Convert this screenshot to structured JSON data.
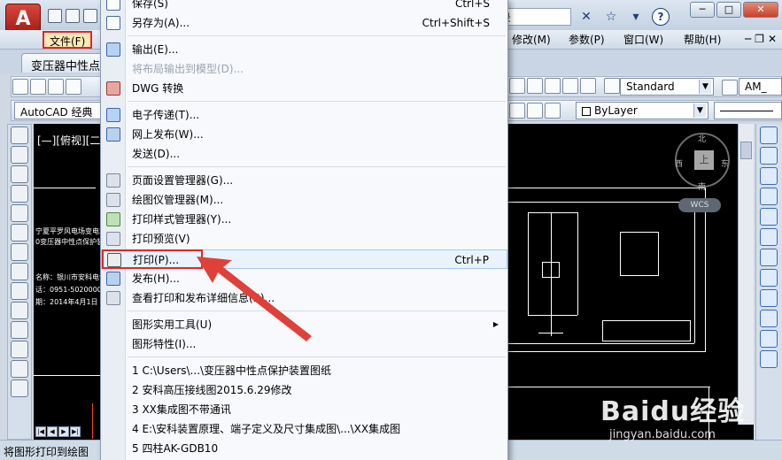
{
  "app": {
    "logo_letter": "A",
    "search_value": "录"
  },
  "menubar": {
    "file": "文件(F)",
    "items": [
      "修改(M)",
      "参数(P)",
      "窗口(W)",
      "帮助(H)"
    ]
  },
  "document_tab": "变压器中性点",
  "toolbar": {
    "workspace": "AutoCAD 经典",
    "text_style": "Standard",
    "dim_style": "AM_",
    "layer_combo": "ByLayer"
  },
  "drawing": {
    "viewport_label": "[—][俯视][二维",
    "viewcube": {
      "top_face": "上",
      "north": "北",
      "south": "南",
      "east": "东",
      "west": "西",
      "wcs": "WCS"
    },
    "title_texts": [
      "宁夏平罗风电场变电站一",
      "0变压器中性点保护装置"
    ],
    "info_texts": [
      "名称：银川市安科电气有限",
      "话：0951-5020000",
      "期：2014年4月1日"
    ]
  },
  "status_bar": "将图形打印到绘图",
  "file_menu": {
    "items": [
      {
        "label": "保存(S)",
        "shortcut": "Ctrl+S",
        "icon": "save-icon"
      },
      {
        "label": "另存为(A)...",
        "shortcut": "Ctrl+Shift+S",
        "icon": "save-as-icon"
      },
      {
        "label": "输出(E)...",
        "icon": "export-icon"
      },
      {
        "label": "将布局输出到模型(D)...",
        "disabled": true
      },
      {
        "label": "DWG 转换",
        "icon": "dwg-convert-icon"
      },
      {
        "label": "电子传递(T)...",
        "icon": "etransmit-icon"
      },
      {
        "label": "网上发布(W)...",
        "icon": "publish-web-icon"
      },
      {
        "label": "发送(D)..."
      },
      {
        "label": "页面设置管理器(G)...",
        "icon": "page-setup-icon"
      },
      {
        "label": "绘图仪管理器(M)...",
        "icon": "plotter-manager-icon"
      },
      {
        "label": "打印样式管理器(Y)...",
        "icon": "plot-style-icon"
      },
      {
        "label": "打印预览(V)",
        "icon": "plot-preview-icon"
      },
      {
        "label": "打印(P)...",
        "shortcut": "Ctrl+P",
        "icon": "print-icon"
      },
      {
        "label": "发布(H)...",
        "icon": "publish-icon"
      },
      {
        "label": "查看打印和发布详细信息(B)...",
        "icon": "plot-details-icon"
      },
      {
        "label": "图形实用工具(U)",
        "submenu": true
      },
      {
        "label": "图形特性(I)..."
      },
      {
        "label": "1 C:\\Users\\...\\变压器中性点保护装置图纸"
      },
      {
        "label": "2 安科高压接线图2015.6.29修改"
      },
      {
        "label": "3 XX集成图不带通讯"
      },
      {
        "label": "4 E:\\安科装置原理、端子定义及尺寸集成图\\...\\XX集成图"
      },
      {
        "label": "5 四柱AK-GDB10"
      }
    ]
  },
  "watermark": {
    "logo": "Baidu经验",
    "url": "jingyan.baidu.com"
  }
}
